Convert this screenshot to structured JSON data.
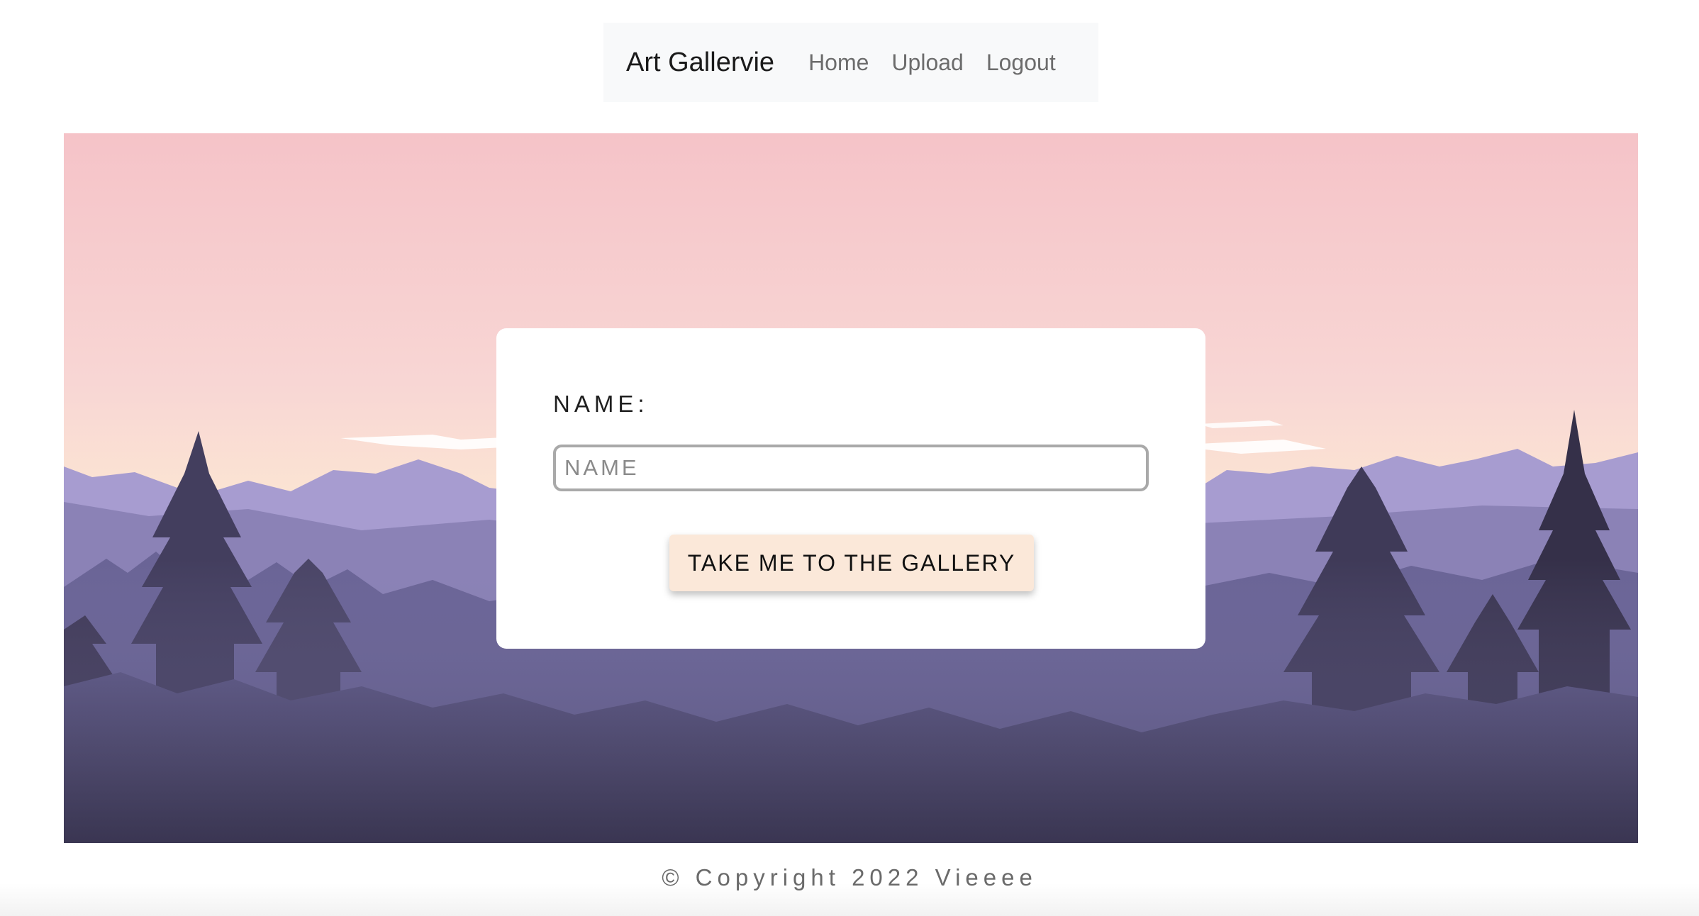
{
  "navbar": {
    "brand": "Art Gallervie",
    "links": [
      {
        "label": "Home"
      },
      {
        "label": "Upload"
      },
      {
        "label": "Logout"
      }
    ]
  },
  "hero": {
    "background": "pink sunset sky over purple mountains and pine forest"
  },
  "form": {
    "label": "NAME:",
    "input_placeholder": "NAME",
    "input_value": "",
    "submit_label": "TAKE ME TO THE GALLERY"
  },
  "footer": {
    "copyright": "© Copyright 2022 Vieeee"
  },
  "colors": {
    "navbar_bg": "#f8f9fa",
    "button_bg": "#fbe8d9",
    "sky_top": "#f5c3c8",
    "sky_horizon": "#fbe3d3",
    "mountain": "#9b8fc6",
    "forest_dark": "#3a3552"
  }
}
